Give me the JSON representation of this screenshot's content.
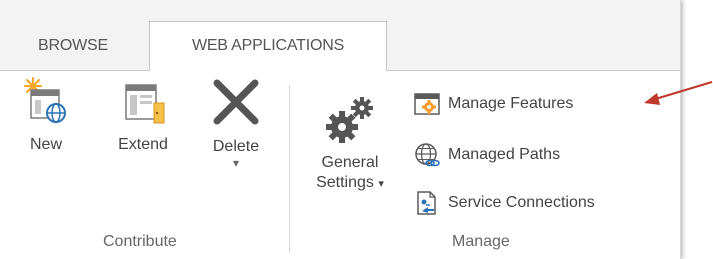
{
  "tabs": [
    {
      "label": "BROWSE",
      "active": false
    },
    {
      "label": "WEB APPLICATIONS",
      "active": true
    }
  ],
  "contribute": {
    "group_label": "Contribute",
    "new_label": "New",
    "extend_label": "Extend",
    "delete_label": "Delete",
    "delete_dropdown": "▾"
  },
  "manage": {
    "group_label": "Manage",
    "general_settings_line1": "General",
    "general_settings_line2": "Settings",
    "general_settings_dropdown": "▾",
    "manage_features_label": "Manage Features",
    "managed_paths_label": "Managed Paths",
    "service_connections_label": "Service Connections"
  },
  "colors": {
    "annotation_arrow": "#c0392b",
    "accent_orange": "#f59d2a",
    "accent_blue": "#2b73b6"
  },
  "icons": [
    "new-web-app-icon",
    "extend-icon",
    "delete-x-icon",
    "gears-icon",
    "manage-features-icon",
    "managed-paths-globe-icon",
    "service-connections-icon",
    "callout-arrow"
  ]
}
